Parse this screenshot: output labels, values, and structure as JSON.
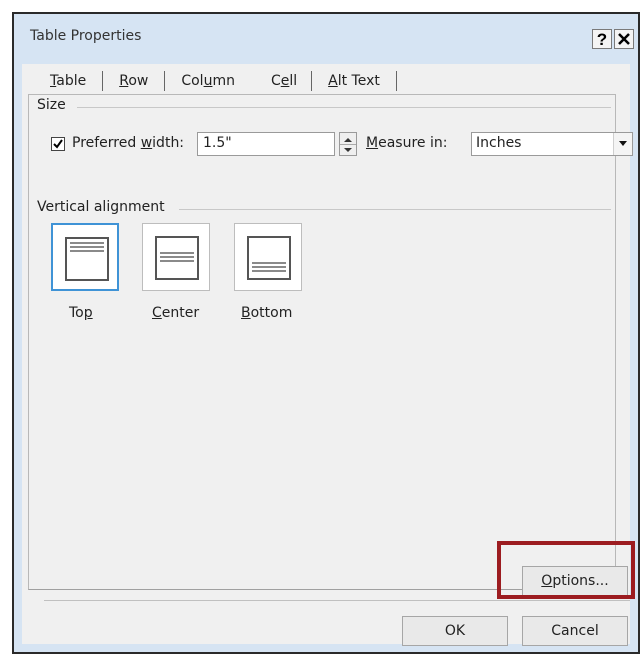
{
  "window": {
    "title": "Table Properties",
    "help": "?",
    "close": "×"
  },
  "tabs": [
    {
      "label_pre": "",
      "label_u": "T",
      "label_post": "able"
    },
    {
      "label_pre": "",
      "label_u": "R",
      "label_post": "ow"
    },
    {
      "label_pre": "Col",
      "label_u": "u",
      "label_post": "mn"
    },
    {
      "label_pre": "C",
      "label_u": "e",
      "label_post": "ll",
      "active": true
    },
    {
      "label_pre": "",
      "label_u": "A",
      "label_post": "lt Text"
    }
  ],
  "size": {
    "group_label": "Size",
    "preferred_width_checked": true,
    "preferred_width_pre": "Preferred ",
    "preferred_width_u": "w",
    "preferred_width_post": "idth:",
    "width_value": "1.5\"",
    "measure_u": "M",
    "measure_post": "easure in:",
    "measure_value": "Inches"
  },
  "vertical_alignment": {
    "group_label": "Vertical alignment",
    "options": [
      {
        "label_pre": "To",
        "label_u": "p",
        "label_post": "",
        "selected": true
      },
      {
        "label_pre": "",
        "label_u": "C",
        "label_post": "enter"
      },
      {
        "label_pre": "",
        "label_u": "B",
        "label_post": "ottom"
      }
    ]
  },
  "buttons": {
    "options_u": "O",
    "options_post": "ptions...",
    "ok": "OK",
    "cancel": "Cancel"
  },
  "colors": {
    "highlight": "#9c1c20",
    "selection": "#3f93d6",
    "titlebar": "#d6e4f3"
  }
}
